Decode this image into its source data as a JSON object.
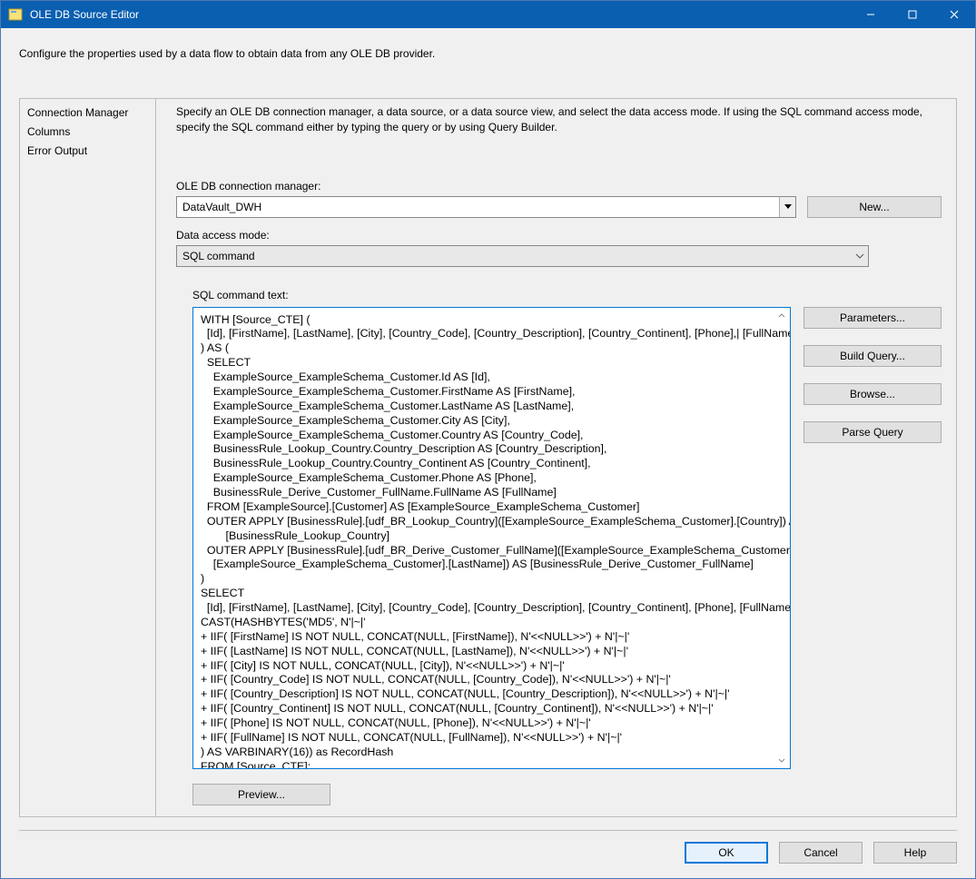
{
  "window": {
    "title": "OLE DB Source Editor",
    "controls": {
      "minimize": "−",
      "maximize": "□",
      "close": "✕"
    }
  },
  "intro": "Configure the properties used by a data flow to obtain data from any OLE DB provider.",
  "nav": {
    "items": [
      {
        "label": "Connection Manager"
      },
      {
        "label": "Columns"
      },
      {
        "label": "Error Output"
      }
    ]
  },
  "pane": {
    "description": "Specify an OLE DB connection manager, a data source, or a data source view, and select the data access mode. If using the SQL command access mode, specify the SQL command either by typing the query or by using Query Builder.",
    "conn_label": "OLE DB connection manager:",
    "conn_value": "DataVault_DWH",
    "new_button": "New...",
    "mode_label": "Data access mode:",
    "mode_value": "SQL command",
    "sql_label": "SQL command text:",
    "sql_text": "WITH [Source_CTE] (\n  [Id], [FirstName], [LastName], [City], [Country_Code], [Country_Description], [Country_Continent], [Phone],| [FullName]\n) AS (\n  SELECT\n    ExampleSource_ExampleSchema_Customer.Id AS [Id],\n    ExampleSource_ExampleSchema_Customer.FirstName AS [FirstName],\n    ExampleSource_ExampleSchema_Customer.LastName AS [LastName],\n    ExampleSource_ExampleSchema_Customer.City AS [City],\n    ExampleSource_ExampleSchema_Customer.Country AS [Country_Code],\n    BusinessRule_Lookup_Country.Country_Description AS [Country_Description],\n    BusinessRule_Lookup_Country.Country_Continent AS [Country_Continent],\n    ExampleSource_ExampleSchema_Customer.Phone AS [Phone],\n    BusinessRule_Derive_Customer_FullName.FullName AS [FullName]\n  FROM [ExampleSource].[Customer] AS [ExampleSource_ExampleSchema_Customer]\n  OUTER APPLY [BusinessRule].[udf_BR_Lookup_Country]([ExampleSource_ExampleSchema_Customer].[Country]) AS\n        [BusinessRule_Lookup_Country]\n  OUTER APPLY [BusinessRule].[udf_BR_Derive_Customer_FullName]([ExampleSource_ExampleSchema_Customer].[FirstName],\n    [ExampleSource_ExampleSchema_Customer].[LastName]) AS [BusinessRule_Derive_Customer_FullName]\n)\nSELECT\n  [Id], [FirstName], [LastName], [City], [Country_Code], [Country_Description], [Country_Continent], [Phone], [FullName],\nCAST(HASHBYTES('MD5', N'|~|'\n+ IIF( [FirstName] IS NOT NULL, CONCAT(NULL, [FirstName]), N'<<NULL>>') + N'|~|'\n+ IIF( [LastName] IS NOT NULL, CONCAT(NULL, [LastName]), N'<<NULL>>') + N'|~|'\n+ IIF( [City] IS NOT NULL, CONCAT(NULL, [City]), N'<<NULL>>') + N'|~|'\n+ IIF( [Country_Code] IS NOT NULL, CONCAT(NULL, [Country_Code]), N'<<NULL>>') + N'|~|'\n+ IIF( [Country_Description] IS NOT NULL, CONCAT(NULL, [Country_Description]), N'<<NULL>>') + N'|~|'\n+ IIF( [Country_Continent] IS NOT NULL, CONCAT(NULL, [Country_Continent]), N'<<NULL>>') + N'|~|'\n+ IIF( [Phone] IS NOT NULL, CONCAT(NULL, [Phone]), N'<<NULL>>') + N'|~|'\n+ IIF( [FullName] IS NOT NULL, CONCAT(NULL, [FullName]), N'<<NULL>>') + N'|~|'\n) AS VARBINARY(16)) as RecordHash\nFROM [Source_CTE];",
    "side_buttons": {
      "parameters": "Parameters...",
      "build_query": "Build Query...",
      "browse": "Browse...",
      "parse_query": "Parse Query"
    },
    "preview_button": "Preview..."
  },
  "footer": {
    "ok": "OK",
    "cancel": "Cancel",
    "help": "Help"
  }
}
